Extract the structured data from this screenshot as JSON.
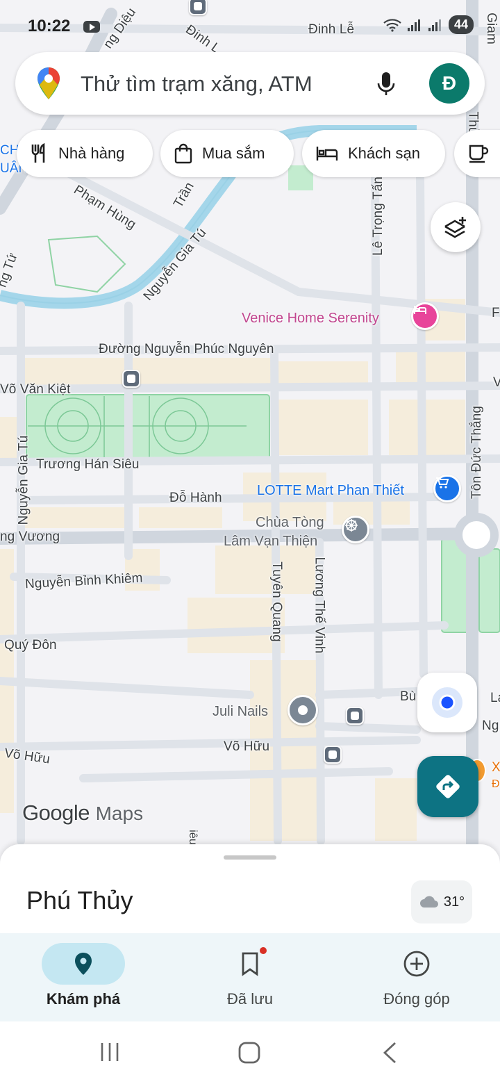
{
  "status_bar": {
    "time": "10:22",
    "battery": "44"
  },
  "search": {
    "placeholder": "Thử tìm trạm xăng, ATM",
    "avatar_letter": "Đ"
  },
  "chips": [
    "Nhà hàng",
    "Mua sắm",
    "Khách sạn"
  ],
  "map": {
    "streets": [
      "Đinh Lễ",
      "Phạm Hùng",
      "Nguyễn Gia Tú",
      "Lê Trọng Tấn",
      "Đường Nguyễn Phúc Nguyên",
      "Võ Văn Kiệt",
      "Trương Hán Siêu",
      "Đỗ Hành",
      "ng Vương",
      "Nguyễn Bỉnh Khiêm",
      "Quý Đôn",
      "Võ Hữu",
      "Võ Hữu",
      "Tuyên Quang",
      "Lương Thế Vinh",
      "Tôn Đức Thắng",
      "Nguyễn Gia Tú",
      "ng Diệu",
      "Đinh L",
      "Trần",
      "ng Tứ",
      "Bù",
      "Ng",
      "La",
      "Thủ",
      "Giam",
      "CH",
      "UÂN",
      "V",
      "F",
      "X",
      "Đ",
      "iêu"
    ],
    "pois": {
      "venice": "Venice Home Serenity",
      "lotte": "LOTTE Mart Phan Thiết",
      "pagoda_line1": "Chùa Tòng",
      "pagoda_line2": "Lâm Vạn Thiện",
      "juli": "Juli Nails"
    },
    "logo_google": "Google",
    "logo_maps": "Maps"
  },
  "sheet": {
    "title": "Phú Thủy",
    "weather": "31°"
  },
  "bottom_nav": {
    "explore": "Khám phá",
    "saved": "Đã lưu",
    "contribute": "Đóng góp"
  },
  "colors": {
    "accent": "#0d7383",
    "park": "#c3eccf",
    "hotel_pin": "#e8449a",
    "shop_pin": "#1a73e8",
    "road": "#d6dbe2"
  }
}
